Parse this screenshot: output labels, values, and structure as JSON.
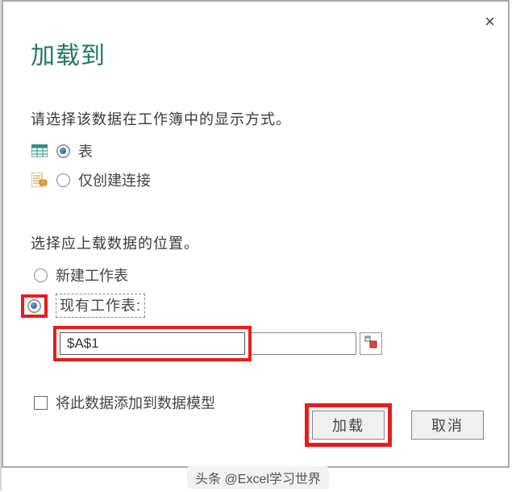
{
  "dialog": {
    "title": "加载到",
    "close_label": "×",
    "display_section": "请选择该数据在工作簿中的显示方式。",
    "option_table": "表",
    "option_connection_only": "仅创建连接",
    "location_section": "选择应上载数据的位置。",
    "option_new_sheet": "新建工作表",
    "option_existing_sheet": "现有工作表:",
    "cell_reference": "$A$1",
    "add_to_model": "将此数据添加到数据模型",
    "btn_load": "加载",
    "btn_cancel": "取消"
  },
  "footer": {
    "text": "头条 @Excel学习世界"
  }
}
